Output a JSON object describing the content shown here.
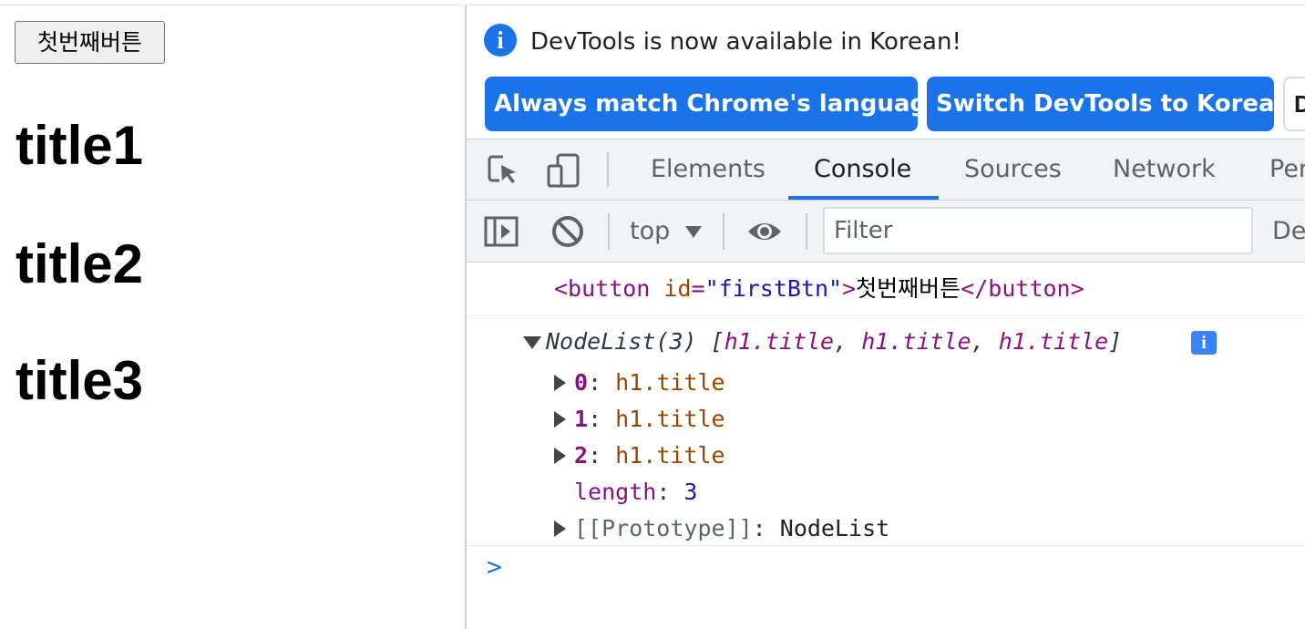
{
  "page": {
    "button_label": "첫번째버튼",
    "headings": [
      "title1",
      "title2",
      "title3"
    ]
  },
  "devtools": {
    "infobar": {
      "message": "DevTools is now available in Korean!",
      "match_language_label": "Always match Chrome's language",
      "switch_label": "Switch DevTools to Korean",
      "third_button_partial": "D"
    },
    "tabs": [
      "Elements",
      "Console",
      "Sources",
      "Network",
      "Per"
    ],
    "active_tab": "Console",
    "console_toolbar": {
      "context": "top",
      "filter_placeholder": "Filter",
      "levels_partial": "De"
    },
    "console": {
      "element_log": {
        "open_tag": "<button",
        "attr_name": "id",
        "attr_eq": "=",
        "attr_value": "\"firstBtn\"",
        "gt": ">",
        "text": "첫번째버튼",
        "close_tag": "</button>"
      },
      "nodelist": {
        "type": "NodeList(3)",
        "bracket_open": "[",
        "preview_items": [
          "h1.title",
          "h1.title",
          "h1.title"
        ],
        "bracket_close": "]",
        "entries": [
          {
            "key": "0",
            "value": "h1.title"
          },
          {
            "key": "1",
            "value": "h1.title"
          },
          {
            "key": "2",
            "value": "h1.title"
          }
        ],
        "length_key": "length",
        "length_value": "3",
        "prototype_key": "[[Prototype]]",
        "prototype_value": "NodeList"
      },
      "prompt": ">"
    }
  },
  "colors": {
    "accent": "#1a73e8",
    "tag": "#881280",
    "attr_name": "#994500",
    "attr_value": "#1a1aa6"
  },
  "icons": [
    "inspect-element-icon",
    "device-toolbar-icon",
    "sidebar-toggle-icon",
    "clear-console-icon",
    "eye-icon",
    "info-icon"
  ]
}
